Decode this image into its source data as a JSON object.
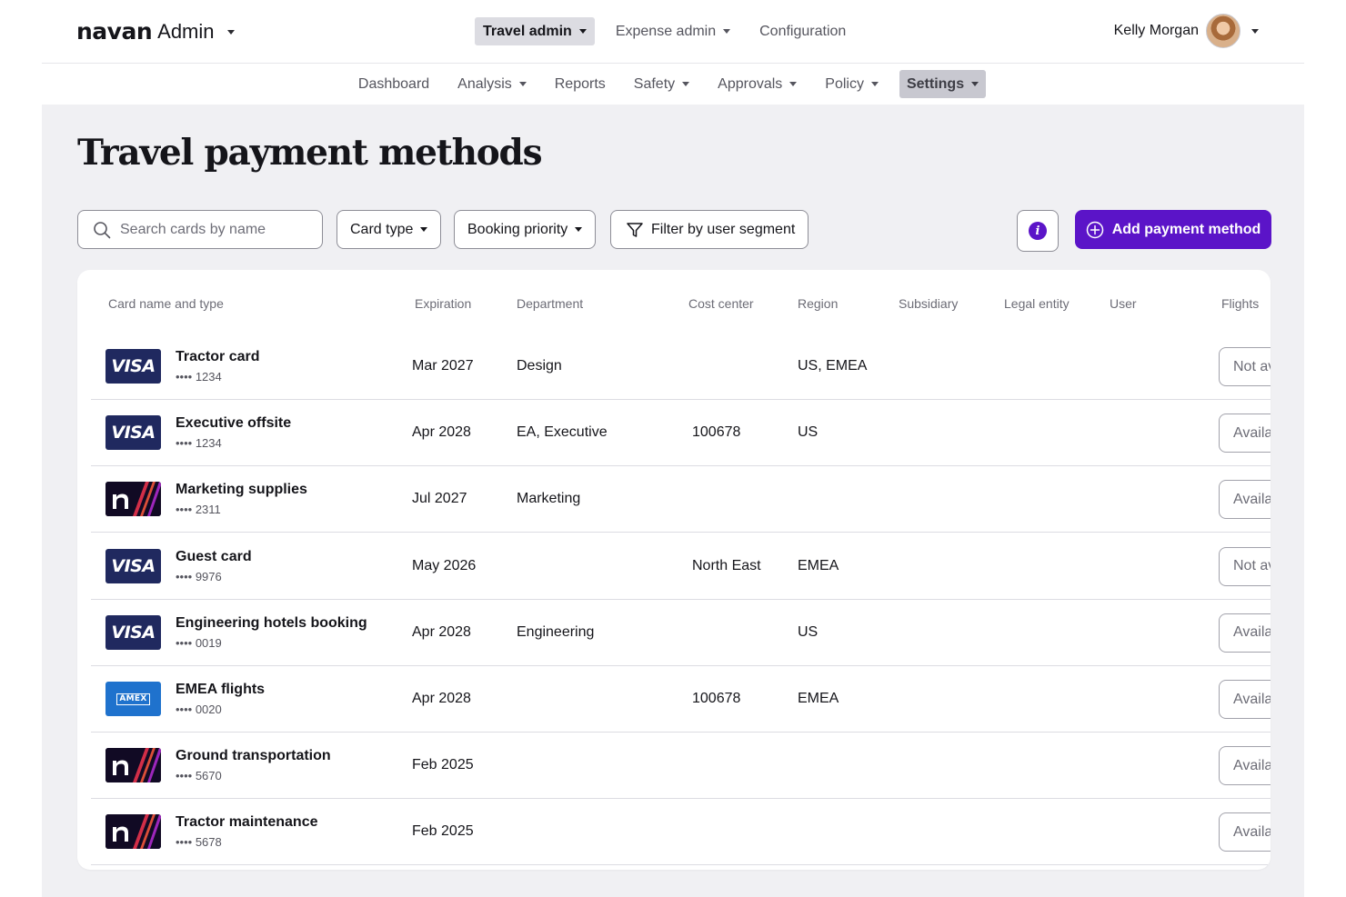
{
  "header": {
    "brand": "navan",
    "brand_suffix": "Admin",
    "tabs": [
      {
        "label": "Travel admin",
        "active": true
      },
      {
        "label": "Expense admin",
        "active": false
      },
      {
        "label": "Configuration",
        "active": false
      }
    ],
    "user_name": "Kelly Morgan"
  },
  "subnav": {
    "items": [
      {
        "label": "Dashboard",
        "dropdown": false,
        "active": false
      },
      {
        "label": "Analysis",
        "dropdown": true,
        "active": false
      },
      {
        "label": "Reports",
        "dropdown": false,
        "active": false
      },
      {
        "label": "Safety",
        "dropdown": true,
        "active": false
      },
      {
        "label": "Approvals",
        "dropdown": true,
        "active": false
      },
      {
        "label": "Policy",
        "dropdown": true,
        "active": false
      },
      {
        "label": "Settings",
        "dropdown": true,
        "active": true
      }
    ]
  },
  "page": {
    "title": "Travel payment methods"
  },
  "toolbar": {
    "search_placeholder": "Search cards by name",
    "card_type_label": "Card type",
    "booking_priority_label": "Booking priority",
    "filter_segment_label": "Filter by user segment",
    "add_label": "Add payment method"
  },
  "table": {
    "columns": {
      "card": "Card name and type",
      "expiration": "Expiration",
      "department": "Department",
      "cost_center": "Cost center",
      "region": "Region",
      "subsidiary": "Subsidiary",
      "legal_entity": "Legal entity",
      "user": "User",
      "flights": "Flights"
    },
    "rows": [
      {
        "brand": "visa",
        "name": "Tractor card",
        "number": "•••• 1234",
        "expiration": "Mar 2027",
        "department": "Design",
        "cost_center": "",
        "region": "US, EMEA",
        "flights": "Not available"
      },
      {
        "brand": "visa",
        "name": "Executive offsite",
        "number": "•••• 1234",
        "expiration": "Apr 2028",
        "department": "EA, Executive",
        "cost_center": "100678",
        "region": "US",
        "flights": "Available"
      },
      {
        "brand": "navan",
        "name": "Marketing supplies",
        "number": "•••• 2311",
        "expiration": "Jul 2027",
        "department": "Marketing",
        "cost_center": "",
        "region": "",
        "flights": "Available"
      },
      {
        "brand": "visa",
        "name": "Guest card",
        "number": "•••• 9976",
        "expiration": "May 2026",
        "department": "",
        "cost_center": "North East",
        "region": "EMEA",
        "flights": "Not available"
      },
      {
        "brand": "visa",
        "name": "Engineering hotels booking",
        "number": "•••• 0019",
        "expiration": "Apr 2028",
        "department": "Engineering",
        "cost_center": "",
        "region": "US",
        "flights": "Available"
      },
      {
        "brand": "amex",
        "name": "EMEA flights",
        "number": "•••• 0020",
        "expiration": "Apr 2028",
        "department": "",
        "cost_center": "100678",
        "region": "EMEA",
        "flights": "Available"
      },
      {
        "brand": "navan",
        "name": "Ground transportation",
        "number": "•••• 5670",
        "expiration": "Feb 2025",
        "department": "",
        "cost_center": "",
        "region": "",
        "flights": "Available"
      },
      {
        "brand": "navan",
        "name": "Tractor maintenance",
        "number": "•••• 5678",
        "expiration": "Feb 2025",
        "department": "",
        "cost_center": "",
        "region": "",
        "flights": "Available"
      }
    ]
  },
  "brand_logos": {
    "visa": "VISA",
    "amex": "AMEX"
  },
  "colors": {
    "accent": "#5b14c8",
    "visa": "#20295f",
    "amex": "#1f72cd",
    "navan_card": "#110a24"
  }
}
